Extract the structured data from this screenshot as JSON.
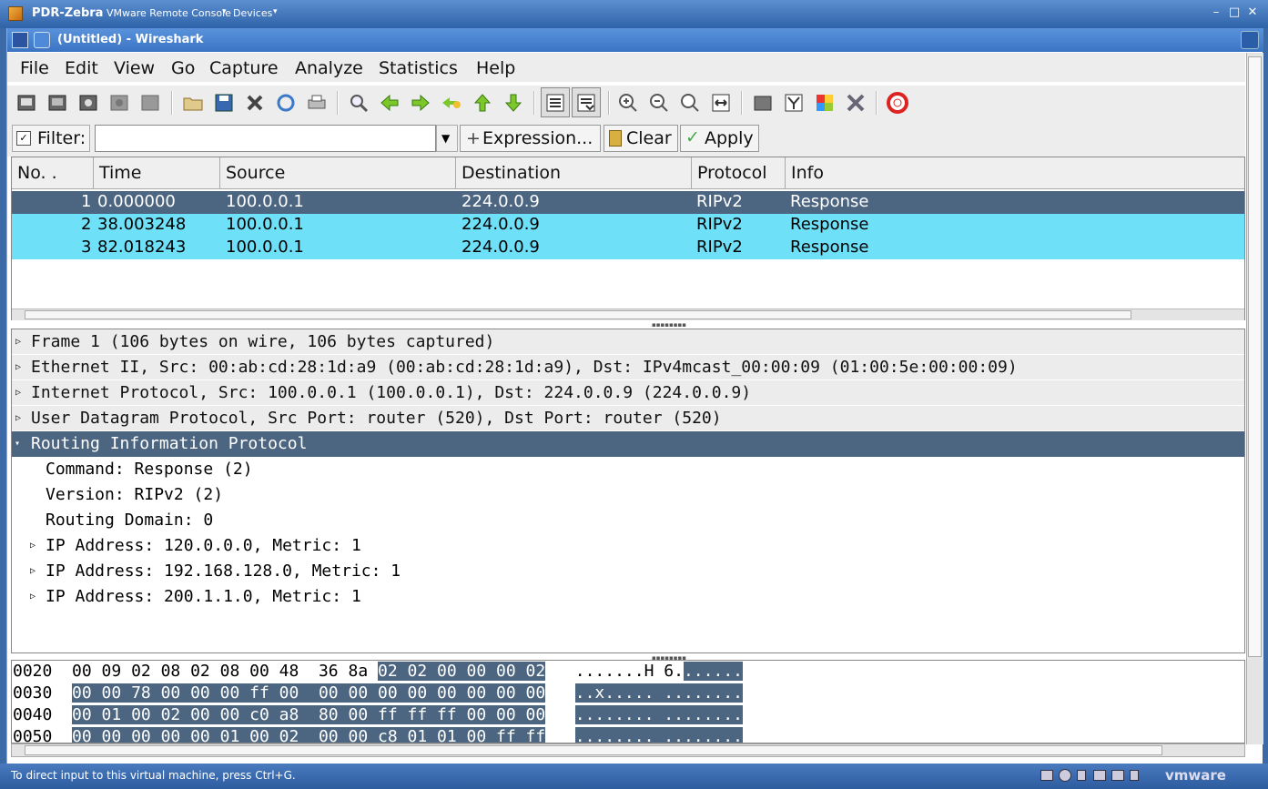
{
  "vmware": {
    "host_name": "PDR-Zebra",
    "console_label": "VMware Remote Console",
    "dropdown_arrow": "▾",
    "devices_label": "Devices",
    "minimize": "–",
    "maximize": "□",
    "close": "✕",
    "status_message": "To direct input to this virtual machine, press Ctrl+G.",
    "brand": "vmware"
  },
  "window": {
    "title": "(Untitled) - Wireshark"
  },
  "menu": [
    "File",
    "Edit",
    "View",
    "Go",
    "Capture",
    "Analyze",
    "Statistics",
    "Help"
  ],
  "filter": {
    "label": "Filter:",
    "value": "",
    "expression_label": "Expression...",
    "clear_label": "Clear",
    "apply_label": "Apply"
  },
  "packet_list": {
    "columns": [
      "No. .",
      "Time",
      "Source",
      "Destination",
      "Protocol",
      "Info"
    ],
    "rows": [
      {
        "no": "1",
        "time": "0.000000",
        "source": "100.0.0.1",
        "destination": "224.0.0.9",
        "protocol": "RIPv2",
        "info": "Response"
      },
      {
        "no": "2",
        "time": "38.003248",
        "source": "100.0.0.1",
        "destination": "224.0.0.9",
        "protocol": "RIPv2",
        "info": "Response"
      },
      {
        "no": "3",
        "time": "82.018243",
        "source": "100.0.0.1",
        "destination": "224.0.0.9",
        "protocol": "RIPv2",
        "info": "Response"
      }
    ],
    "selected_row": 1
  },
  "details": [
    {
      "text": "Frame 1 (106 bytes on wire, 106 bytes captured)",
      "level": 0,
      "expander": "collapsed"
    },
    {
      "text": "Ethernet II, Src: 00:ab:cd:28:1d:a9 (00:ab:cd:28:1d:a9), Dst: IPv4mcast_00:00:09 (01:00:5e:00:00:09)",
      "level": 0,
      "expander": "collapsed"
    },
    {
      "text": "Internet Protocol, Src: 100.0.0.1 (100.0.0.1), Dst: 224.0.0.9 (224.0.0.9)",
      "level": 0,
      "expander": "collapsed"
    },
    {
      "text": "User Datagram Protocol, Src Port: router (520), Dst Port: router (520)",
      "level": 0,
      "expander": "collapsed"
    },
    {
      "text": "Routing Information Protocol",
      "level": 0,
      "expander": "expanded",
      "selected": true
    },
    {
      "text": "Command: Response (2)",
      "level": 1,
      "expander": "none"
    },
    {
      "text": "Version: RIPv2 (2)",
      "level": 1,
      "expander": "none"
    },
    {
      "text": "Routing Domain: 0",
      "level": 1,
      "expander": "none"
    },
    {
      "text": "IP Address: 120.0.0.0, Metric: 1",
      "level": 1,
      "expander": "collapsed"
    },
    {
      "text": "IP Address: 192.168.128.0, Metric: 1",
      "level": 1,
      "expander": "collapsed"
    },
    {
      "text": "IP Address: 200.1.1.0, Metric: 1",
      "level": 1,
      "expander": "collapsed"
    }
  ],
  "hex": [
    {
      "offset": "0020",
      "bytes_plain": "00 09 02 08 02 08 00 48  36 8a ",
      "bytes_sel": "02 02 00 00 00 02",
      "ascii_plain": ".......H 6.",
      "ascii_sel": "......"
    },
    {
      "offset": "0030",
      "bytes_plain": "",
      "bytes_sel": "00 00 78 00 00 00 ff 00  00 00 00 00 00 00 00 00",
      "ascii_plain": "",
      "ascii_sel": "..x..... ........"
    },
    {
      "offset": "0040",
      "bytes_plain": "",
      "bytes_sel": "00 01 00 02 00 00 c0 a8  80 00 ff ff ff 00 00 00",
      "ascii_plain": "",
      "ascii_sel": "........ ........"
    },
    {
      "offset": "0050",
      "bytes_plain": "",
      "bytes_sel": "00 00 00 00 00 01 00 02  00 00 c8 01 01 00 ff ff",
      "ascii_plain": "",
      "ascii_sel": "........ ........"
    }
  ],
  "colors": {
    "selected_bg": "#4c6580",
    "highlight_bg": "#6ee0f8",
    "title_bg": "#3b74c4"
  }
}
